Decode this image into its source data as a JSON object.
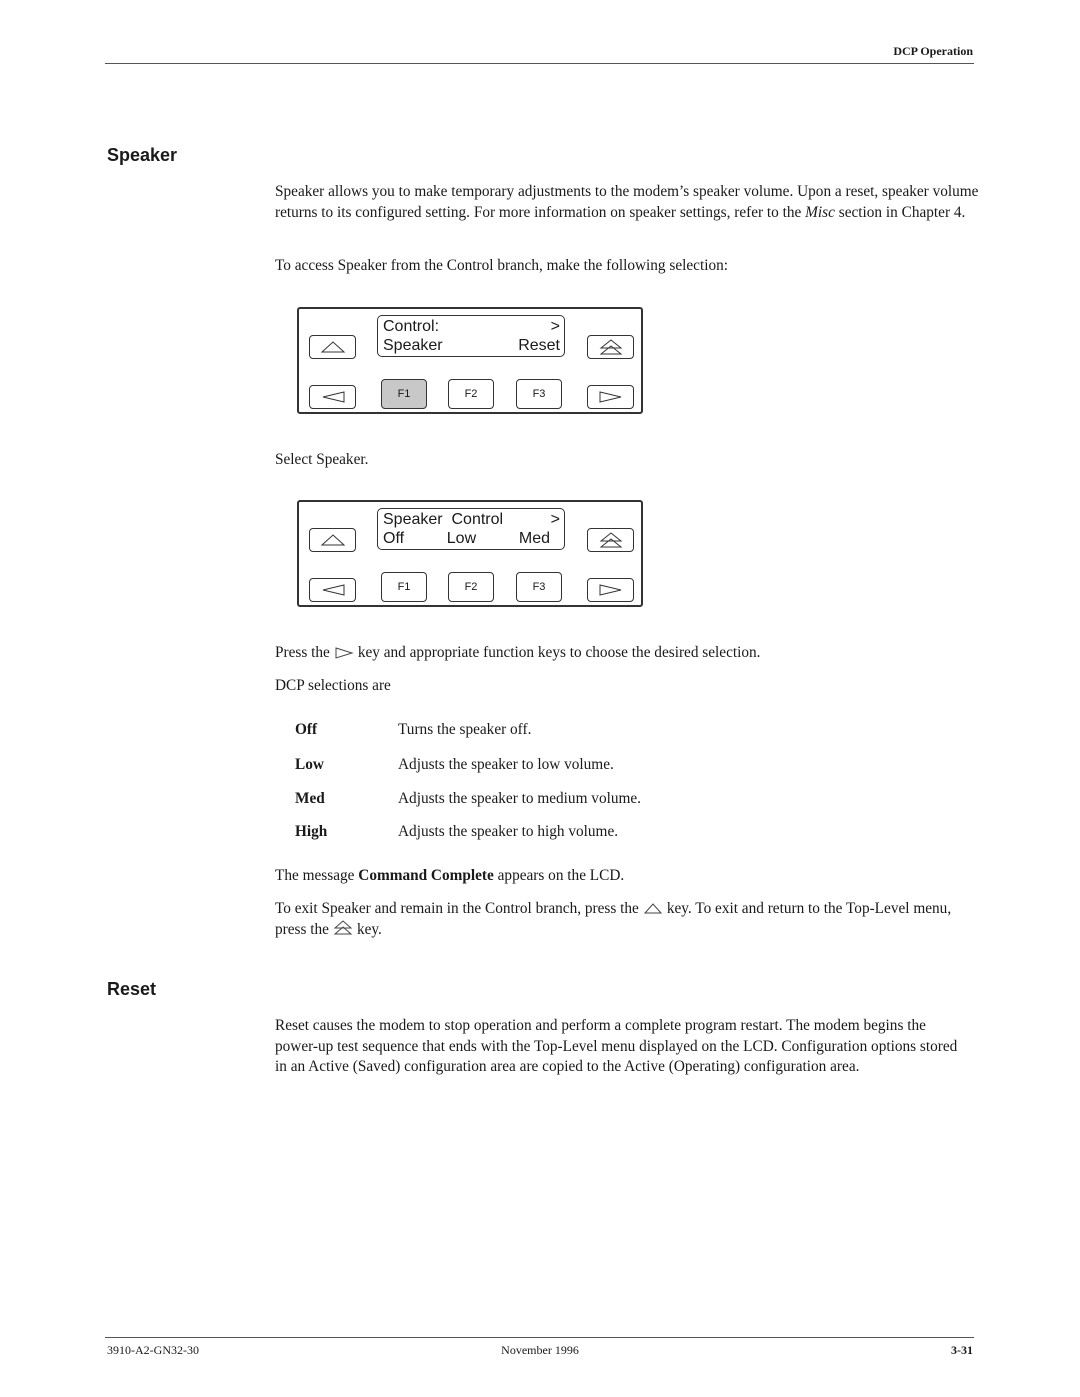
{
  "header": {
    "section_title": "DCP Operation"
  },
  "speaker": {
    "heading": "Speaker",
    "intro_part1": "Speaker allows you to make temporary adjustments to the modem’s speaker volume. Upon a reset, speaker volume returns to its configured setting. For more information on speaker settings, refer to the ",
    "intro_italic": "Misc",
    "intro_part2": " section in Chapter 4.",
    "access_text": "To access Speaker from the Control branch, make the following selection:",
    "panel1": {
      "lcd_line1_left": "Control:",
      "lcd_line1_right": ">",
      "lcd_line2_left": "Speaker",
      "lcd_line2_right": "Reset",
      "fkeys": [
        "F1",
        "F2",
        "F3"
      ],
      "active_fkey": "F1",
      "icons": {
        "up": "up-arrow-key-icon",
        "top": "top-level-key-icon",
        "left": "left-arrow-key-icon",
        "right": "right-arrow-key-icon"
      }
    },
    "select_text": "Select Speaker.",
    "panel2": {
      "lcd_line1_left": "Speaker  Control",
      "lcd_line1_right": ">",
      "lcd_line2_cols": [
        "Off",
        "Low",
        "Med"
      ],
      "fkeys": [
        "F1",
        "F2",
        "F3"
      ],
      "active_fkey": ""
    },
    "press_before": "Press the",
    "press_after": "key and appropriate function keys to choose the desired selection.",
    "selections_intro": "DCP selections are",
    "selections": [
      {
        "term": "Off",
        "desc": "Turns the speaker off."
      },
      {
        "term": "Low",
        "desc": "Adjusts the speaker to low volume."
      },
      {
        "term": "Med",
        "desc": "Adjusts the speaker to medium volume."
      },
      {
        "term": "High",
        "desc": "Adjusts the speaker to high volume."
      }
    ],
    "message_before": "The message ",
    "message_bold": "Command Complete",
    "message_after": " appears on the LCD.",
    "exit_part1": "To exit Speaker and remain in the Control branch, press the",
    "exit_part2": "key. To exit and return to the Top-Level menu, press the",
    "exit_part3": "key."
  },
  "reset": {
    "heading": "Reset",
    "body": "Reset causes the modem to stop operation and perform a complete program restart. The modem begins the power-up test sequence that ends with the Top-Level menu displayed on the LCD. Configuration options stored in an Active (Saved) configuration area are copied to the Active (Operating) configuration area."
  },
  "footer": {
    "doc_number": "3910-A2-GN32-30",
    "date": "November 1996",
    "page_number": "3-31"
  }
}
